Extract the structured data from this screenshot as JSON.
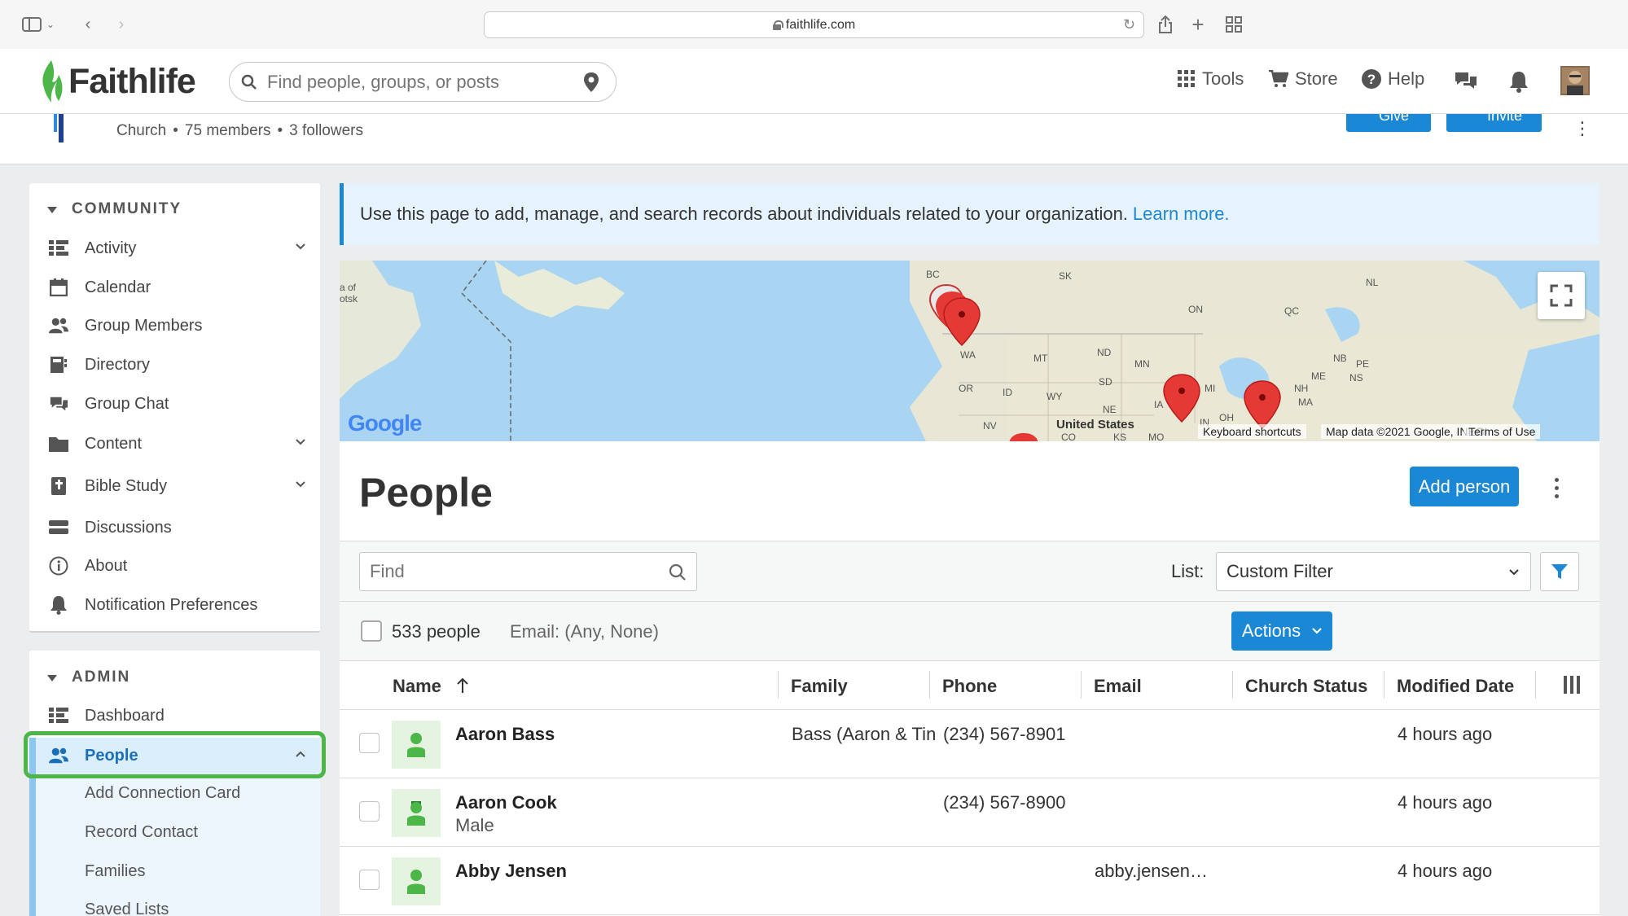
{
  "browser": {
    "url": "faithlife.com"
  },
  "site": {
    "logo_text": "Faithlife",
    "search_placeholder": "Find people, groups, or posts",
    "nav": {
      "tools": "Tools",
      "store": "Store",
      "help": "Help"
    }
  },
  "group": {
    "type": "Church",
    "members": "75 members",
    "followers": "3 followers",
    "give_label": "Give",
    "invite_label": "Invite"
  },
  "sidebar": {
    "community_title": "COMMUNITY",
    "community_items": [
      {
        "label": "Activity",
        "icon": "activity-icon"
      },
      {
        "label": "Calendar",
        "icon": "calendar-icon"
      },
      {
        "label": "Group Members",
        "icon": "group-members-icon"
      },
      {
        "label": "Directory",
        "icon": "directory-icon"
      },
      {
        "label": "Group Chat",
        "icon": "chat-icon"
      },
      {
        "label": "Content",
        "icon": "folder-icon"
      },
      {
        "label": "Bible Study",
        "icon": "bible-icon"
      },
      {
        "label": "Discussions",
        "icon": "discussions-icon"
      },
      {
        "label": "About",
        "icon": "info-icon"
      },
      {
        "label": "Notification Preferences",
        "icon": "bell-icon"
      }
    ],
    "admin_title": "ADMIN",
    "admin_items": [
      {
        "label": "Dashboard",
        "icon": "dashboard-icon"
      },
      {
        "label": "People",
        "icon": "people-icon"
      }
    ],
    "people_sub": [
      "Add Connection Card",
      "Record Contact",
      "Families",
      "Saved Lists"
    ]
  },
  "banner": {
    "text": "Use this page to add, manage, and search records about individuals related to your organization.",
    "link": "Learn more."
  },
  "map": {
    "labels": [
      "BC",
      "SK",
      "NL",
      "ON",
      "QC",
      "WA",
      "MT",
      "ND",
      "MN",
      "PE",
      "NB",
      "NS",
      "ME",
      "OR",
      "ID",
      "WY",
      "SD",
      "MI",
      "NH",
      "MA",
      "NE",
      "IA",
      "OH",
      "IN",
      "NV",
      "CO",
      "KS",
      "MO",
      "United States",
      "a of",
      "otsk"
    ],
    "brand": "Google",
    "footer": {
      "shortcuts": "Keyboard shortcuts",
      "data": "Map data ©2021 Google, INEGI",
      "terms": "Terms of Use"
    }
  },
  "people": {
    "title": "People",
    "add_button": "Add person",
    "find_placeholder": "Find",
    "list_label": "List:",
    "list_value": "Custom Filter",
    "count": "533 people",
    "email_filter": "Email: (Any, None)",
    "actions_label": "Actions",
    "columns": [
      "Name",
      "Family",
      "Phone",
      "Email",
      "Church Status",
      "Modified Date"
    ],
    "rows": [
      {
        "name": "Aaron Bass",
        "sub": "",
        "family": "Bass (Aaron & Tin",
        "phone": "(234) 567-8901",
        "email": "",
        "status": "",
        "modified": "4 hours ago"
      },
      {
        "name": "Aaron Cook",
        "sub": "Male",
        "family": "",
        "phone": "(234) 567-8900",
        "email": "",
        "status": "",
        "modified": "4 hours ago"
      },
      {
        "name": "Abby Jensen",
        "sub": "",
        "family": "",
        "phone": "",
        "email": "abby.jensen…",
        "status": "",
        "modified": "4 hours ago"
      }
    ]
  },
  "colors": {
    "accent": "#1b88d6",
    "brand_green": "#4cb748",
    "active_bg": "#dbeefb"
  }
}
